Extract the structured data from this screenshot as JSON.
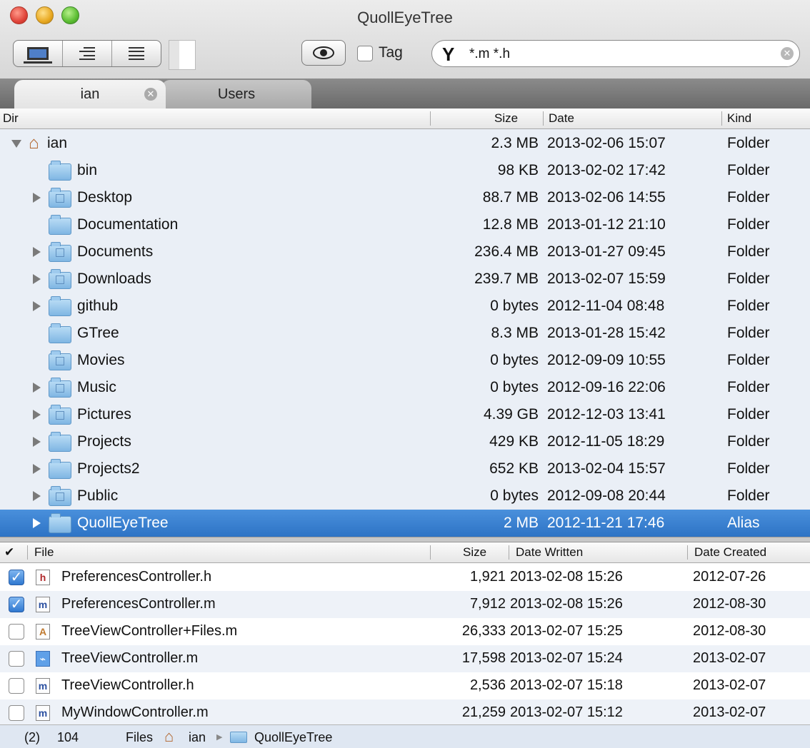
{
  "window": {
    "title": "QuollEyeTree"
  },
  "toolbar": {
    "tag_label": "Tag",
    "filter_value": "*.m *.h",
    "filter_icon": "funnel-icon"
  },
  "tabs": [
    {
      "label": "ian"
    },
    {
      "label": "Users"
    }
  ],
  "dir_table": {
    "columns": {
      "dir": "Dir",
      "size": "Size",
      "date": "Date",
      "kind": "Kind"
    },
    "rows": [
      {
        "name": "ian",
        "size": "2.3 MB",
        "date": "2013-02-06 15:07",
        "kind": "Folder",
        "icon": "home-icon",
        "expanded": true
      },
      {
        "name": "bin",
        "size": "98 KB",
        "date": "2013-02-02 17:42",
        "kind": "Folder",
        "icon": "folder-icon"
      },
      {
        "name": "Desktop",
        "size": "88.7 MB",
        "date": "2013-02-06 14:55",
        "kind": "Folder",
        "icon": "desktop-folder-icon"
      },
      {
        "name": "Documentation",
        "size": "12.8 MB",
        "date": "2013-01-12 21:10",
        "kind": "Folder",
        "icon": "folder-icon"
      },
      {
        "name": "Documents",
        "size": "236.4 MB",
        "date": "2013-01-27 09:45",
        "kind": "Folder",
        "icon": "documents-folder-icon"
      },
      {
        "name": "Downloads",
        "size": "239.7 MB",
        "date": "2013-02-07 15:59",
        "kind": "Folder",
        "icon": "downloads-folder-icon"
      },
      {
        "name": "github",
        "size": "0 bytes",
        "date": "2012-11-04 08:48",
        "kind": "Folder",
        "icon": "folder-icon"
      },
      {
        "name": "GTree",
        "size": "8.3 MB",
        "date": "2013-01-28 15:42",
        "kind": "Folder",
        "icon": "folder-icon"
      },
      {
        "name": "Movies",
        "size": "0 bytes",
        "date": "2012-09-09 10:55",
        "kind": "Folder",
        "icon": "movies-folder-icon"
      },
      {
        "name": "Music",
        "size": "0 bytes",
        "date": "2012-09-16 22:06",
        "kind": "Folder",
        "icon": "music-folder-icon"
      },
      {
        "name": "Pictures",
        "size": "4.39 GB",
        "date": "2012-12-03 13:41",
        "kind": "Folder",
        "icon": "pictures-folder-icon"
      },
      {
        "name": "Projects",
        "size": "429 KB",
        "date": "2012-11-05 18:29",
        "kind": "Folder",
        "icon": "folder-icon"
      },
      {
        "name": "Projects2",
        "size": "652 KB",
        "date": "2013-02-04 15:57",
        "kind": "Folder",
        "icon": "folder-icon"
      },
      {
        "name": "Public",
        "size": "0 bytes",
        "date": "2012-09-08 20:44",
        "kind": "Folder",
        "icon": "public-folder-icon"
      },
      {
        "name": "QuollEyeTree",
        "size": "2 MB",
        "date": "2012-11-21 17:46",
        "kind": "Alias",
        "icon": "folder-icon",
        "selected": true
      }
    ]
  },
  "file_table": {
    "columns": {
      "check": "✔",
      "file": "File",
      "size": "Size",
      "date_written": "Date Written",
      "date_created": "Date Created"
    },
    "rows": [
      {
        "checked": true,
        "icon": "h",
        "name": "PreferencesController.h",
        "size": "1,921",
        "written": "2013-02-08 15:26",
        "created": "2012-07-26"
      },
      {
        "checked": true,
        "icon": "m",
        "name": "PreferencesController.m",
        "size": "7,912",
        "written": "2013-02-08 15:26",
        "created": "2012-08-30"
      },
      {
        "checked": false,
        "icon": "plus",
        "name": "TreeViewController+Files.m",
        "size": "26,333",
        "written": "2013-02-07 15:25",
        "created": "2012-08-30"
      },
      {
        "checked": false,
        "icon": "xcode",
        "name": "TreeViewController.m",
        "size": "17,598",
        "written": "2013-02-07 15:24",
        "created": "2013-02-07"
      },
      {
        "checked": false,
        "icon": "m",
        "name": "TreeViewController.h",
        "size": "2,536",
        "written": "2013-02-07 15:18",
        "created": "2013-02-07"
      },
      {
        "checked": false,
        "icon": "m",
        "name": "MyWindowController.m",
        "size": "21,259",
        "written": "2013-02-07 15:12",
        "created": "2013-02-07"
      }
    ]
  },
  "status": {
    "selected_count": "(2)",
    "file_count": "104",
    "files_label": "Files",
    "path_home": "ian",
    "path_folder": "QuollEyeTree"
  }
}
